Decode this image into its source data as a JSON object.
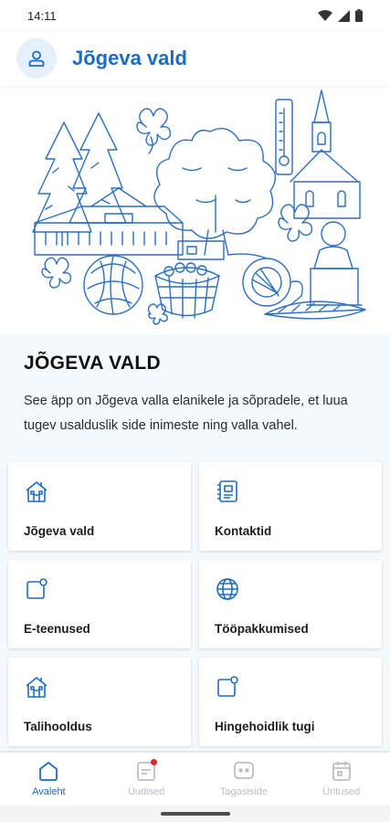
{
  "status_bar": {
    "time": "14:11"
  },
  "header": {
    "title": "Jõgeva vald"
  },
  "intro": {
    "title": "JÕGEVA VALD",
    "text": "See äpp on Jõgeva valla elanikele ja sõpradele, et luua tugev usalduslik side inimeste ning valla vahel."
  },
  "tiles": [
    {
      "label": "Jõgeva vald",
      "icon": "house-icon"
    },
    {
      "label": "Kontaktid",
      "icon": "contacts-icon"
    },
    {
      "label": "E-teenused",
      "icon": "notification-square-icon"
    },
    {
      "label": "Tööpakkumised",
      "icon": "globe-icon"
    },
    {
      "label": "Talihooldus",
      "icon": "house-icon"
    },
    {
      "label": "Hingehoidlik tugi",
      "icon": "notification-square-icon"
    }
  ],
  "bottom_nav": [
    {
      "label": "Avaleht",
      "icon": "home-icon",
      "active": true
    },
    {
      "label": "Uudised",
      "icon": "news-icon",
      "badge": true
    },
    {
      "label": "Tagasiside",
      "icon": "feedback-icon"
    },
    {
      "label": "Üritused",
      "icon": "calendar-icon"
    }
  ],
  "colors": {
    "accent": "#1d6bc4",
    "inactive": "#b9bec6",
    "background": "#f4f9fd",
    "badge": "#e0282a"
  }
}
